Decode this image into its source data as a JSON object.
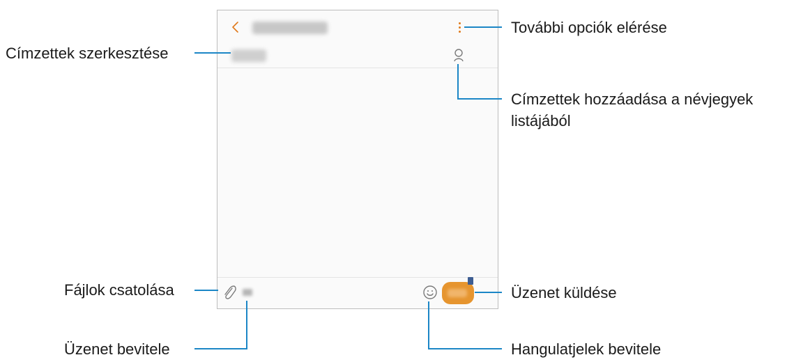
{
  "callouts": {
    "more_options": "További opciók elérése",
    "edit_recipients": "Címzettek szerkesztése",
    "add_from_contacts_line1": "Címzettek hozzáadása a névjegyek",
    "add_from_contacts_line2": "listájából",
    "attach_files": "Fájlok csatolása",
    "send_message": "Üzenet küldése",
    "enter_message": "Üzenet bevitele",
    "enter_emoticons": "Hangulatjelek bevitele"
  },
  "colors": {
    "accent": "#e07a1c",
    "send_button": "#e6952f",
    "callout_line": "#1b86c6",
    "border": "#bdbdbd"
  },
  "icons": {
    "back": "chevron-left-icon",
    "more": "more-vertical-icon",
    "contact": "contact-person-icon",
    "attach": "paperclip-icon",
    "emoji": "smiley-face-icon",
    "send": "send-button"
  }
}
